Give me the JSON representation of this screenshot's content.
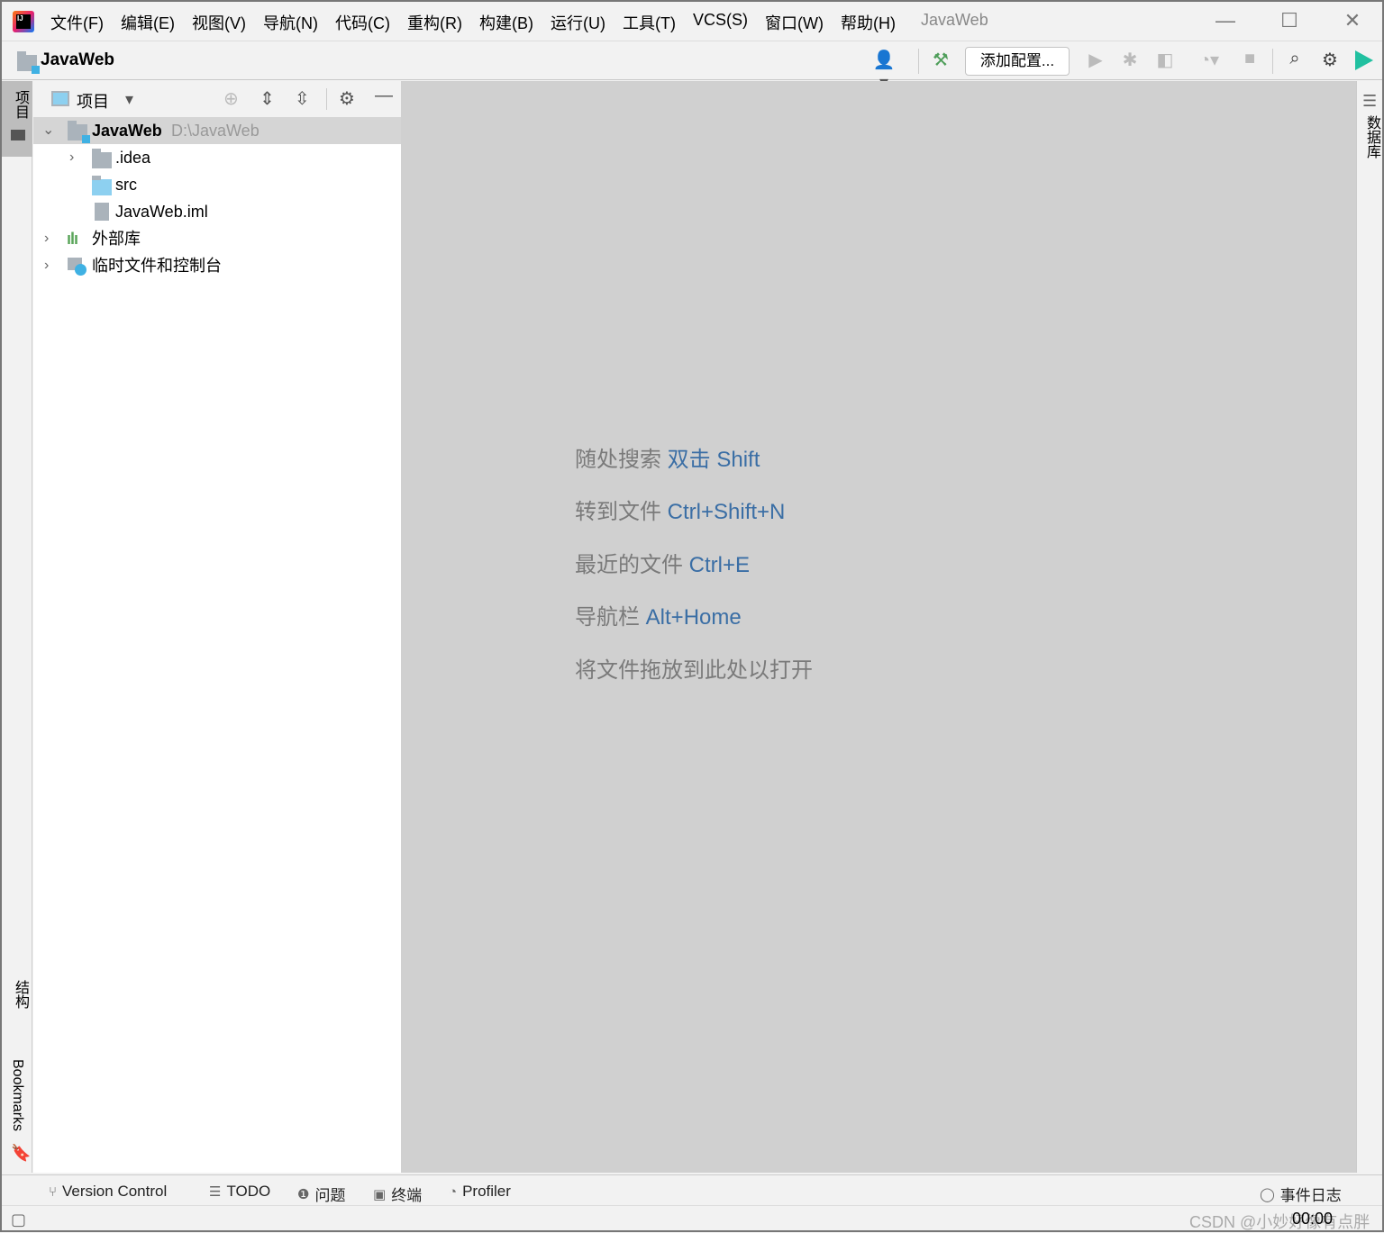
{
  "menubar": {
    "items": [
      "文件(F)",
      "编辑(E)",
      "视图(V)",
      "导航(N)",
      "代码(C)",
      "重构(R)",
      "构建(B)",
      "运行(U)",
      "工具(T)",
      "VCS(S)",
      "窗口(W)",
      "帮助(H)"
    ],
    "window_title": "JavaWeb"
  },
  "navbar": {
    "project": "JavaWeb",
    "add_config": "添加配置..."
  },
  "left_strip": {
    "project": "项目",
    "structure": "结构",
    "bookmarks": "Bookmarks"
  },
  "right_strip": {
    "database": "数据库"
  },
  "project_panel": {
    "title": "项目",
    "tree": [
      {
        "name": "JavaWeb",
        "path": "D:\\JavaWeb"
      },
      {
        "name": ".idea"
      },
      {
        "name": "src"
      },
      {
        "name": "JavaWeb.iml"
      },
      {
        "name": "外部库"
      },
      {
        "name": "临时文件和控制台"
      }
    ]
  },
  "editor": {
    "hints": [
      {
        "text": "随处搜索",
        "key": "双击 Shift"
      },
      {
        "text": "转到文件",
        "key": "Ctrl+Shift+N"
      },
      {
        "text": "最近的文件",
        "key": "Ctrl+E"
      },
      {
        "text": "导航栏",
        "key": "Alt+Home"
      },
      {
        "text": "将文件拖放到此处以打开",
        "key": ""
      }
    ]
  },
  "toolwindows": {
    "vcs": "Version Control",
    "todo": "TODO",
    "problems": "问题",
    "terminal": "终端",
    "profiler": "Profiler",
    "event_log": "事件日志"
  },
  "status": {
    "time": "00:00",
    "watermark": "CSDN @小妙好像有点胖"
  },
  "colors": {
    "accent": "#3a6ea5",
    "editor_bg": "#d0d0d0",
    "build": "#4f9e5a"
  }
}
